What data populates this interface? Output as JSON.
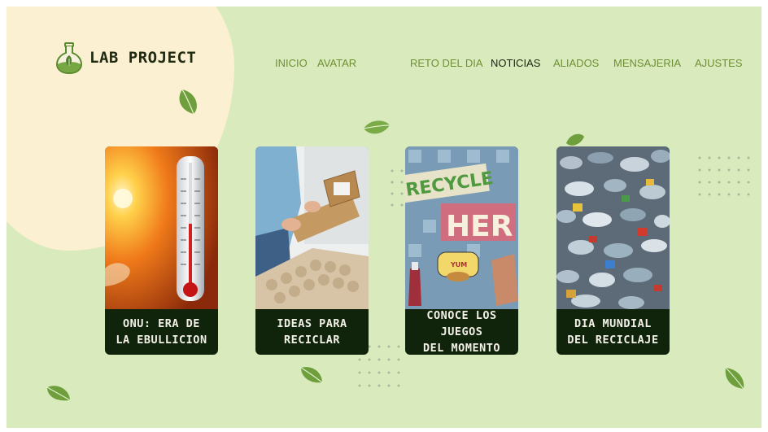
{
  "brand": {
    "name": "LAB PROJECT",
    "icon": "flask-leaf-icon"
  },
  "nav": {
    "items": [
      {
        "label": "INICIO",
        "active": false
      },
      {
        "label": "AVATAR",
        "active": false
      },
      {
        "label": "RETO DEL DIA",
        "active": false
      },
      {
        "label": "NOTICIAS",
        "active": true
      },
      {
        "label": "ALIADOS",
        "active": false
      },
      {
        "label": "MENSAJERIA",
        "active": false
      },
      {
        "label": "AJUSTES",
        "active": false
      }
    ]
  },
  "cards": [
    {
      "title": "ONU: ERA DE\nLA EBULLICION",
      "image": "thermometer-sun-image"
    },
    {
      "title": "IDEAS PARA\nRECICLAR",
      "image": "cardboard-recycling-image"
    },
    {
      "title": "CONOCE LOS JUEGOS\nDEL MOMENTO",
      "image": "recycle-here-collage-image",
      "image_text": [
        "RECYCLE",
        "HER",
        "YUM"
      ]
    },
    {
      "title": "DIA MUNDIAL\nDEL RECICLAJE",
      "image": "plastic-bottles-image"
    }
  ],
  "colors": {
    "background": "#d9ebbd",
    "blob": "#fbf0d2",
    "card_caption": "#10240c",
    "nav_text": "#6e8f33",
    "nav_active": "#1c2410",
    "leaf": "#76a742"
  }
}
